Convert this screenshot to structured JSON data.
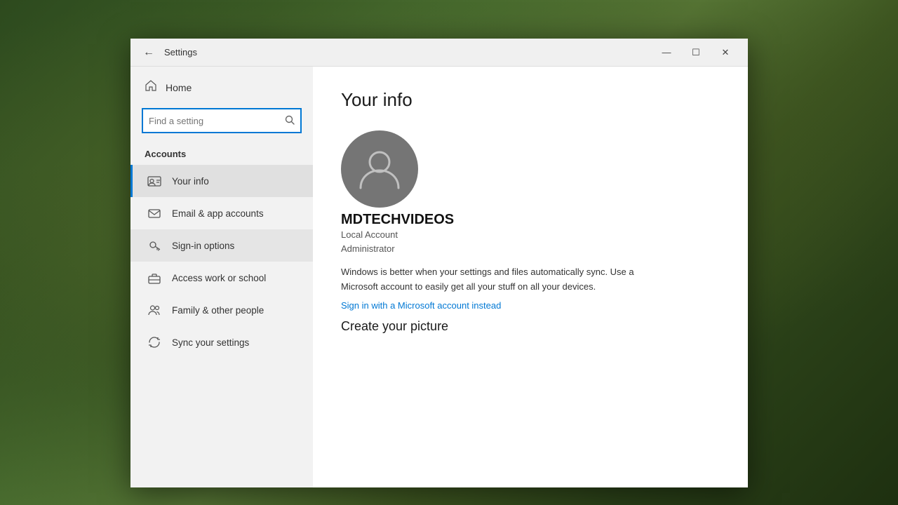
{
  "desktop": {
    "background": "forest"
  },
  "window": {
    "title": "Settings",
    "controls": {
      "minimize": "—",
      "maximize": "☐",
      "close": "✕"
    }
  },
  "sidebar": {
    "home_label": "Home",
    "search_placeholder": "Find a setting",
    "section_label": "Accounts",
    "nav_items": [
      {
        "id": "your-info",
        "label": "Your info",
        "icon": "person-card",
        "active": true
      },
      {
        "id": "email-app-accounts",
        "label": "Email & app accounts",
        "icon": "email"
      },
      {
        "id": "sign-in-options",
        "label": "Sign-in options",
        "icon": "key",
        "hovered": true
      },
      {
        "id": "access-work-school",
        "label": "Access work or school",
        "icon": "briefcase"
      },
      {
        "id": "family-other-people",
        "label": "Family & other people",
        "icon": "people"
      },
      {
        "id": "sync-settings",
        "label": "Sync your settings",
        "icon": "sync"
      }
    ]
  },
  "main": {
    "page_title": "Your info",
    "profile": {
      "username": "MDTECHVIDEOS",
      "account_type_line1": "Local Account",
      "account_type_line2": "Administrator"
    },
    "sync_description": "Windows is better when your settings and files automatically sync. Use a Microsoft account to easily get all your stuff on all your devices.",
    "microsoft_link": "Sign in with a Microsoft account instead",
    "create_picture_heading": "Create your picture"
  }
}
